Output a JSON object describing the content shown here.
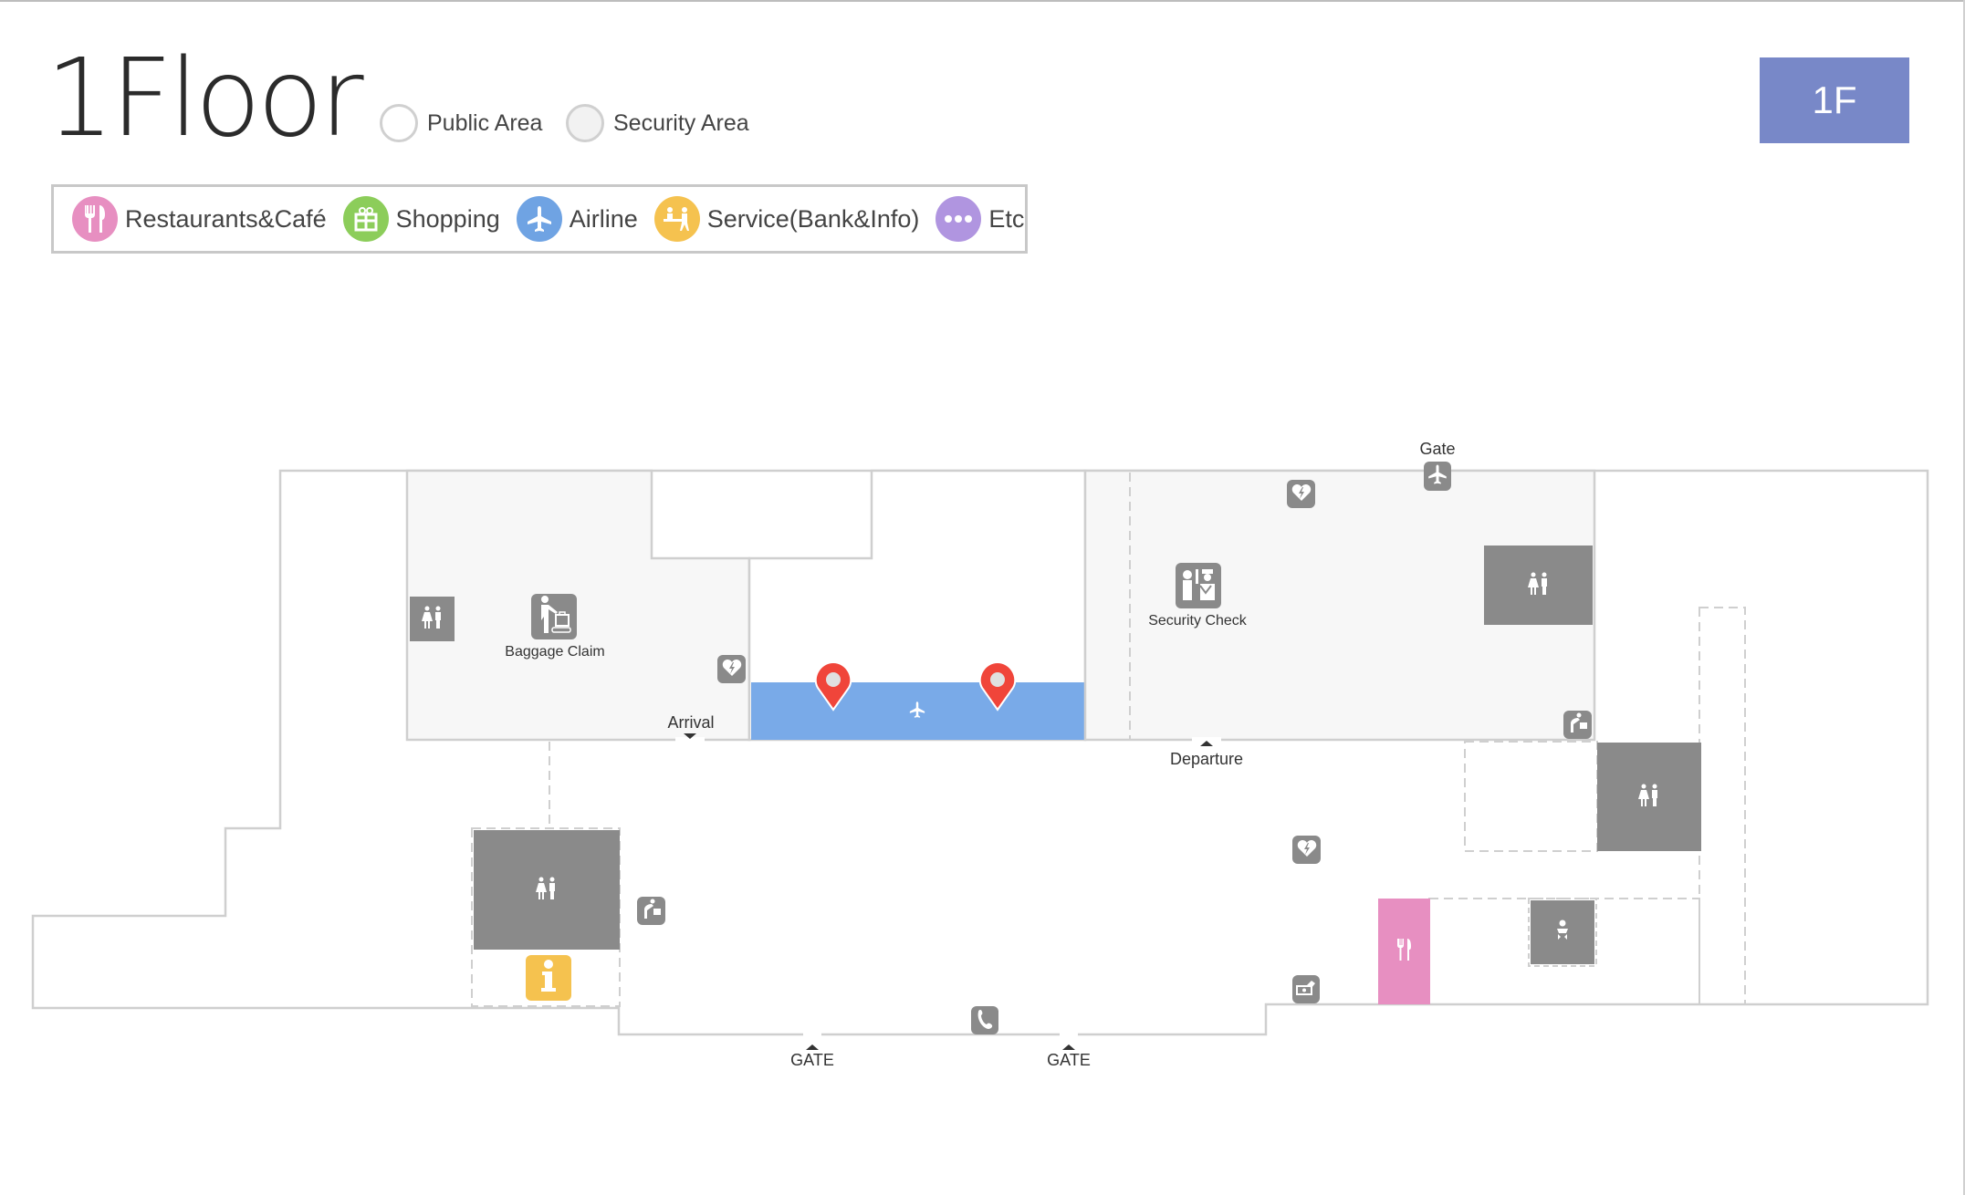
{
  "header": {
    "floor_title": "1Floor",
    "area_filters": [
      {
        "label": "Public Area",
        "selected": false
      },
      {
        "label": "Security Area",
        "selected": false
      }
    ],
    "floor_button": "1F"
  },
  "legend": [
    {
      "label": "Restaurants&Café",
      "icon": "fork-knife-icon",
      "color": "#e78fc1"
    },
    {
      "label": "Shopping",
      "icon": "gift-icon",
      "color": "#8ccd5a"
    },
    {
      "label": "Airline",
      "icon": "airplane-icon",
      "color": "#6fa3e3"
    },
    {
      "label": "Service(Bank&Info)",
      "icon": "service-desk-icon",
      "color": "#f5c24f"
    },
    {
      "label": "Etc",
      "icon": "more-dots-icon",
      "color": "#b095e0"
    }
  ],
  "map": {
    "areas": {
      "baggage_claim": "Baggage Claim",
      "security_check": "Security Check",
      "arrival": "Arrival",
      "departure": "Departure",
      "gate_top": "Gate",
      "gate_bottom_1": "GATE",
      "gate_bottom_2": "GATE"
    },
    "colors": {
      "wall": "#cfcfcf",
      "room_fill": "#f7f7f7",
      "facility_gray": "#8a8a8a",
      "airline_highlight": "#79aae8",
      "restaurant_pink": "#e78fc1",
      "info_yellow": "#f5c24f",
      "pin_red": "#f0453a"
    },
    "facilities": [
      {
        "type": "restroom",
        "icon": "restroom-icon"
      },
      {
        "type": "baggage-claim",
        "icon": "baggage-claim-icon"
      },
      {
        "type": "aed",
        "icon": "aed-icon"
      },
      {
        "type": "airline-counter",
        "icon": "airplane-icon"
      },
      {
        "type": "security-check",
        "icon": "security-check-icon"
      },
      {
        "type": "drinking-fountain",
        "icon": "drinking-fountain-icon"
      },
      {
        "type": "information",
        "icon": "info-icon"
      },
      {
        "type": "telephone",
        "icon": "phone-icon"
      },
      {
        "type": "currency-exchange",
        "icon": "currency-exchange-icon"
      },
      {
        "type": "restaurant",
        "icon": "fork-knife-icon"
      },
      {
        "type": "nursing-room",
        "icon": "baby-icon"
      }
    ],
    "location_pins": 2
  }
}
